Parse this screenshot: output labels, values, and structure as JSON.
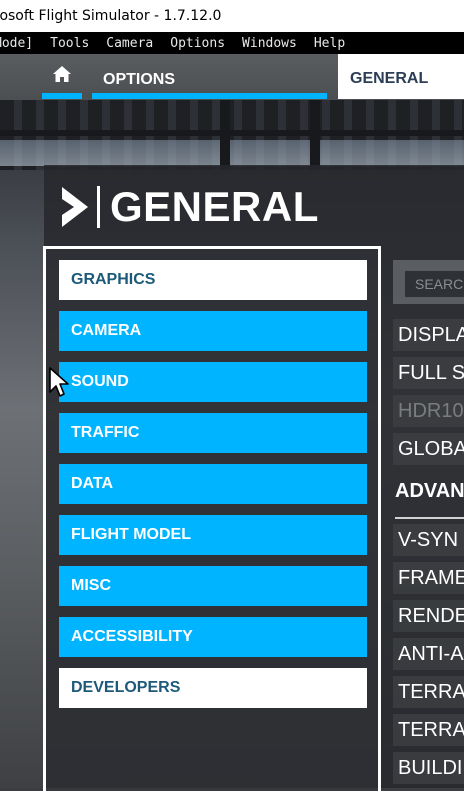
{
  "window": {
    "title": "rosoft Flight Simulator - 1.7.12.0"
  },
  "dev_menu": {
    "items": [
      "Mode]",
      "Tools",
      "Camera",
      "Options",
      "Windows",
      "Help"
    ]
  },
  "nav": {
    "options_label": "OPTIONS",
    "general_tab_label": "GENERAL"
  },
  "section": {
    "title": "GENERAL"
  },
  "categories": [
    {
      "label": "GRAPHICS",
      "selected": true
    },
    {
      "label": "CAMERA",
      "selected": false
    },
    {
      "label": "SOUND",
      "selected": false
    },
    {
      "label": "TRAFFIC",
      "selected": false
    },
    {
      "label": "DATA",
      "selected": false
    },
    {
      "label": "FLIGHT MODEL",
      "selected": false
    },
    {
      "label": "MISC",
      "selected": false
    },
    {
      "label": "ACCESSIBILITY",
      "selected": false
    },
    {
      "label": "DEVELOPERS",
      "selected": false
    }
  ],
  "search": {
    "placeholder": "SEARC"
  },
  "settings_rows": [
    {
      "label": "DISPLA",
      "dim": false
    },
    {
      "label": "FULL S",
      "dim": false
    },
    {
      "label": "HDR10",
      "dim": true
    },
    {
      "label": "GLOBA",
      "dim": false
    }
  ],
  "advanced": {
    "header": "ADVAN",
    "rows": [
      "V-SYN",
      "FRAME",
      "RENDE",
      "ANTI-A",
      "TERRA",
      "TERRA",
      "BUILDI"
    ]
  },
  "colors": {
    "accent": "#00b4ff",
    "selected_text": "#1d5a7a",
    "panel_border": "#ffffff"
  }
}
